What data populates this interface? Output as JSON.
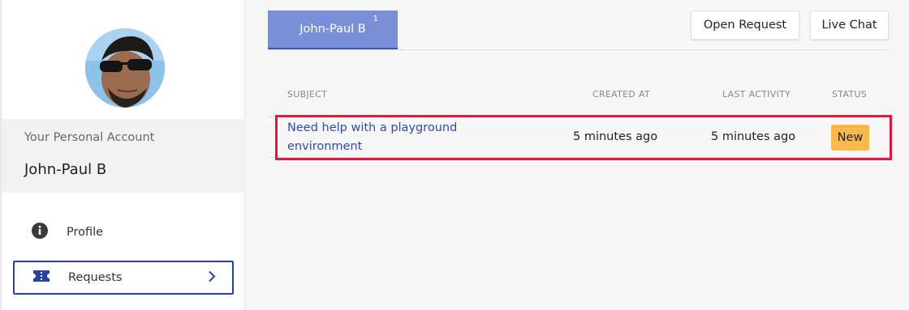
{
  "sidebar": {
    "account_label": "Your Personal Account",
    "account_name": "John-Paul B",
    "items": [
      {
        "label": "Profile",
        "icon": "info-icon"
      },
      {
        "label": "Requests",
        "icon": "ticket-icon",
        "active": true
      }
    ]
  },
  "header": {
    "tabs": [
      {
        "label": "John-Paul B",
        "count": "1"
      }
    ],
    "buttons": {
      "open_request": "Open Request",
      "live_chat": "Live Chat"
    }
  },
  "table": {
    "columns": [
      "SUBJECT",
      "CREATED AT",
      "LAST ACTIVITY",
      "STATUS"
    ],
    "rows": [
      {
        "subject": "Need help with a playground environment",
        "created_at": "5 minutes ago",
        "last_activity": "5 minutes ago",
        "status": "New"
      }
    ]
  },
  "colors": {
    "accent": "#2741a6",
    "tab_bg": "#7b8fd8",
    "link": "#2d4bb4",
    "status_new": "#f9b84a",
    "highlight": "#e8143c"
  }
}
